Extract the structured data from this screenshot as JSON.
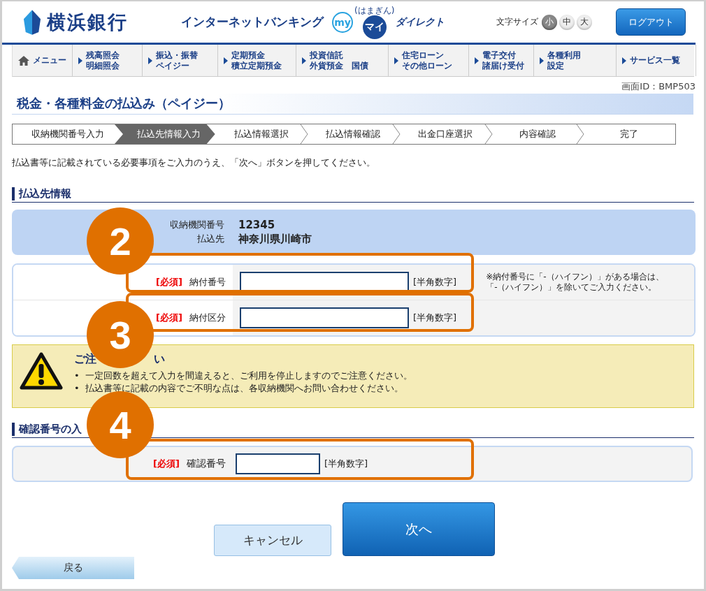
{
  "header": {
    "bank_name": "横浜銀行",
    "service_title": "インターネットバンキング",
    "logo_my": "my",
    "logo_hamagin": "(はまぎん)",
    "logo_mai": "マイ",
    "logo_direct": "ダイレクト",
    "font_size_label": "文字サイズ",
    "font_sizes": [
      {
        "label": "小",
        "selected": true
      },
      {
        "label": "中",
        "selected": false
      },
      {
        "label": "大",
        "selected": false
      }
    ],
    "logout": "ログアウト"
  },
  "nav": [
    {
      "kind": "home",
      "lines": [
        "メニュー"
      ]
    },
    {
      "kind": "link",
      "lines": [
        "残高照会",
        "明細照会"
      ]
    },
    {
      "kind": "link",
      "lines": [
        "振込・振替",
        "ペイジー"
      ]
    },
    {
      "kind": "link",
      "lines": [
        "定期預金",
        "積立定期預金"
      ]
    },
    {
      "kind": "link",
      "lines": [
        "投資信託",
        "外貨預金　国債"
      ]
    },
    {
      "kind": "link",
      "lines": [
        "住宅ローン",
        "その他ローン"
      ]
    },
    {
      "kind": "link",
      "lines": [
        "電子交付",
        "諸届け受付"
      ]
    },
    {
      "kind": "link",
      "lines": [
        "各種利用",
        "設定"
      ]
    },
    {
      "kind": "link",
      "lines": [
        "サービス一覧"
      ]
    }
  ],
  "screen_id": "画面ID：BMP503",
  "page_title": "税金・各種料金の払込み（ペイジー）",
  "steps": [
    {
      "label": "収納機関番号入力",
      "selected": false
    },
    {
      "label": "払込先情報入力",
      "selected": true
    },
    {
      "label": "払込情報選択",
      "selected": false
    },
    {
      "label": "払込情報確認",
      "selected": false
    },
    {
      "label": "出金口座選択",
      "selected": false
    },
    {
      "label": "内容確認",
      "selected": false
    },
    {
      "label": "完了",
      "selected": false
    }
  ],
  "instruction": "払込書等に記載されている必要事項をご入力のうえ、「次へ」ボタンを押してください。",
  "payee_section": {
    "heading": "払込先情報",
    "info": [
      {
        "label": "収納機関番号",
        "value": "12345"
      },
      {
        "label": "払込先",
        "value": "神奈川県川崎市"
      }
    ],
    "fields": [
      {
        "required": "[必須]",
        "label": "納付番号",
        "hint": "[半角数字]",
        "note": [
          "※納付番号に「-（ハイフン）」がある場合は、",
          "「-（ハイフン）」を除いてご入力ください。"
        ]
      },
      {
        "required": "[必須]",
        "label": "納付区分",
        "hint": "[半角数字]"
      }
    ]
  },
  "warning": {
    "title_parts": [
      "ご注",
      "い"
    ],
    "items": [
      {
        "bullet": "•",
        "text": "一定回数を超えて入力を間違えると、ご利用を停止しますのでご注意ください。"
      },
      {
        "bullet": "•",
        "text": "払込書等に記載の内容でご不明な点は、各収納機関へお問い合わせください。"
      }
    ]
  },
  "confirm_section": {
    "heading": "確認番号の入",
    "field": {
      "required": "[必須]",
      "label": "確認番号",
      "hint": "[半角数字]"
    }
  },
  "buttons": {
    "cancel": "キャンセル",
    "next": "次へ",
    "back": "戻る"
  },
  "annotations": [
    {
      "number": "2"
    },
    {
      "number": "3"
    },
    {
      "number": "4"
    }
  ]
}
